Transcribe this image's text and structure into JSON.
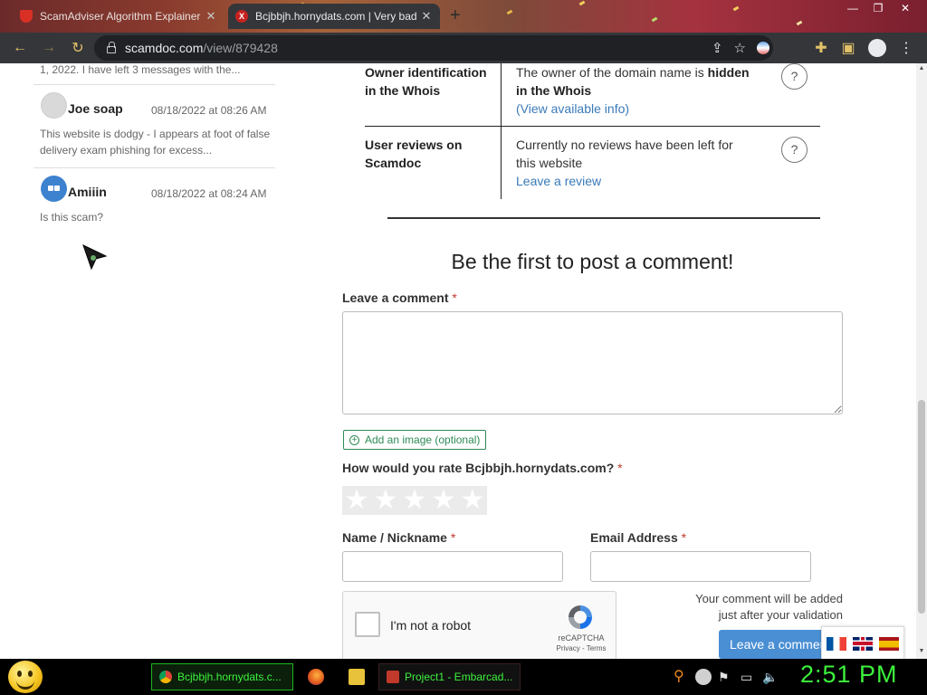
{
  "browser": {
    "tabs": [
      {
        "title": "ScamAdviser Algorithm Explainer",
        "active": false
      },
      {
        "title": "Bcjbbjh.hornydats.com | Very bad",
        "active": true
      }
    ],
    "new_tab_label": "+",
    "url_host": "scamdoc.com",
    "url_path": "/view/879428"
  },
  "comments": {
    "truncated_top": "1, 2022. I have left 3 messages with the...",
    "items": [
      {
        "name": "Joe soap",
        "date": "08/18/2022 at 08:26 AM",
        "text": "This website is dodgy - I appears at foot of false delivery exam phishing for excess...",
        "avatar": "default-avatar-icon"
      },
      {
        "name": "Amiiin",
        "date": "08/18/2022 at 08:24 AM",
        "text": "Is this scam?",
        "avatar": "robot-avatar-icon"
      }
    ]
  },
  "info_rows": [
    {
      "label": "Owner identification in the Whois",
      "text_before": "The owner of the domain name is ",
      "text_bold": "hidden in the Whois",
      "link": "(View available info)",
      "help": "?"
    },
    {
      "label": "User reviews on Scamdoc",
      "text": "Currently no reviews have been left for this website",
      "link": "Leave a review",
      "help": "?"
    }
  ],
  "form": {
    "heading": "Be the first to post a comment!",
    "comment_label": "Leave a comment",
    "required_mark": "*",
    "add_image": "Add an image (optional)",
    "rate_label": "How would you rate Bcjbbjh.hornydats.com?",
    "rating": {
      "value": 0,
      "max": 5
    },
    "name_label": "Name / Nickname",
    "email_label": "Email Address",
    "recaptcha_text": "I'm not a robot",
    "recaptcha_brand": "reCAPTCHA",
    "recaptcha_terms": "Privacy - Terms",
    "note_line1": "Your comment will be added",
    "note_line2": "just after your validation",
    "submit_label": "Leave a comment"
  },
  "languages": [
    "fr-flag-icon",
    "uk-flag-icon",
    "es-flag-icon"
  ],
  "taskbar": {
    "tasks": [
      "Bcjbbjh.hornydats.c...",
      "Project1 - Embarcad..."
    ],
    "clock": "2:51 PM"
  },
  "colors": {
    "link": "#3a7ab8",
    "required": "#c0392b",
    "submit": "#4a8fd4",
    "add_image": "#2e8b57",
    "taskbar_text": "#3df23d"
  }
}
